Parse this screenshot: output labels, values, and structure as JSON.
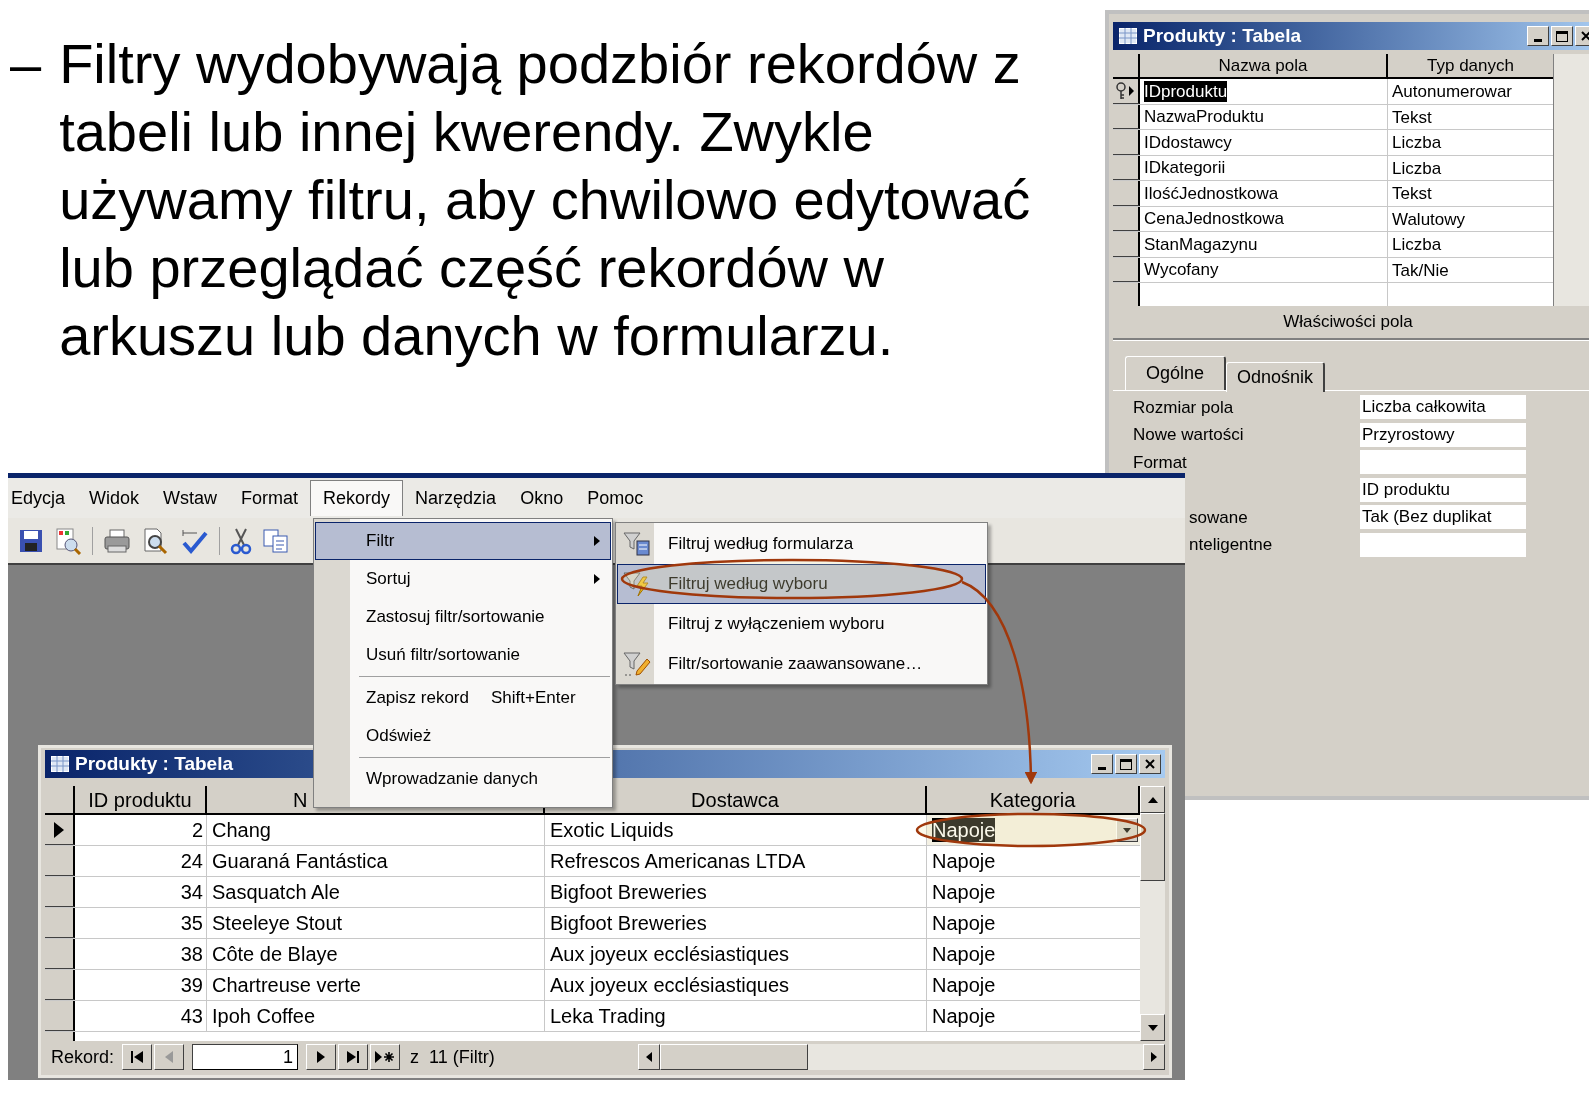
{
  "slide": {
    "bullet": "–",
    "text": "Filtry wydobywają podzbiór rekordów z tabeli lub innej kwerendy. Zwykle używamy filtru, aby chwilowo edytować lub przeglądać część rekordów w arkuszu lub danych w formularzu."
  },
  "design_window": {
    "title": "Produkty : Tabela",
    "columns": [
      "Nazwa pola",
      "Typ danych"
    ],
    "fields": [
      {
        "name": "IDproduktu",
        "type": "Autonumerowar",
        "selected": true
      },
      {
        "name": "NazwaProduktu",
        "type": "Tekst",
        "selected": false
      },
      {
        "name": "IDdostawcy",
        "type": "Liczba",
        "selected": false
      },
      {
        "name": "IDkategorii",
        "type": "Liczba",
        "selected": false
      },
      {
        "name": "IlośćJednostkowa",
        "type": "Tekst",
        "selected": false
      },
      {
        "name": "CenaJednostkowa",
        "type": "Walutowy",
        "selected": false
      },
      {
        "name": "StanMagazynu",
        "type": "Liczba",
        "selected": false
      },
      {
        "name": "Wycofany",
        "type": "Tak/Nie",
        "selected": false
      }
    ],
    "properties_title": "Właściwości pola",
    "tabs": [
      {
        "label": "Ogólne",
        "selected": true
      },
      {
        "label": "Odnośnik",
        "selected": false
      }
    ],
    "properties": [
      {
        "label": "Rozmiar pola",
        "value": "Liczba całkowita",
        "cut": false
      },
      {
        "label": "Nowe wartości",
        "value": "Przyrostowy",
        "cut": false
      },
      {
        "label": "Format",
        "cut": false
      },
      {
        "value": "ID produktu"
      },
      {
        "label": "sowane",
        "value": "Tak (Bez duplikat",
        "cut": true
      },
      {
        "label": "nteligentne",
        "cut": true
      }
    ]
  },
  "access_window": {
    "menu": [
      {
        "label": "Edycja",
        "selected": false
      },
      {
        "label": "Widok",
        "selected": false
      },
      {
        "label": "Wstaw",
        "selected": false
      },
      {
        "label": "Format",
        "selected": false
      },
      {
        "label": "Rekordy",
        "selected": true
      },
      {
        "label": "Narzędzia",
        "selected": false
      },
      {
        "label": "Okno",
        "selected": false
      },
      {
        "label": "Pomoc",
        "selected": false
      }
    ],
    "records_menu": [
      {
        "kind": "item",
        "label": "Filtr",
        "selected": true,
        "submenu": true
      },
      {
        "kind": "item",
        "label": "Sortuj",
        "selected": false,
        "submenu": true
      },
      {
        "kind": "item",
        "label": "Zastosuj filtr/sortowanie",
        "selected": false,
        "submenu": false
      },
      {
        "kind": "item",
        "label": "Usuń filtr/sortowanie",
        "selected": false,
        "submenu": false
      },
      {
        "kind": "separator"
      },
      {
        "kind": "item",
        "label": "Zapisz rekord",
        "shortcut": "Shift+Enter",
        "selected": false,
        "submenu": false
      },
      {
        "kind": "item",
        "label": "Odśwież",
        "selected": false,
        "submenu": false
      },
      {
        "kind": "separator"
      },
      {
        "kind": "item",
        "label": "Wprowadzanie danych",
        "selected": false,
        "submenu": false
      }
    ],
    "filter_submenu": [
      {
        "kind": "form",
        "label": "Filtruj według formularza",
        "selected": false
      },
      {
        "kind": "selection",
        "label": "Filtruj według wyboru",
        "selected": true
      },
      {
        "kind": "plain",
        "label": "Filtruj z wyłączeniem wyboru",
        "selected": false
      },
      {
        "kind": "advanced",
        "label": "Filtr/sortowanie zaawansowane…",
        "selected": false
      }
    ],
    "datasheet": {
      "title": "Produkty : Tabela",
      "columns": [
        "ID produktu",
        "N",
        "Dostawca",
        "Kategoria"
      ],
      "rows": [
        {
          "id": "2",
          "name": "Chang",
          "supplier": "Exotic Liquids",
          "category": "Napoje",
          "selected": true
        },
        {
          "id": "24",
          "name": "Guaraná Fantástica",
          "supplier": "Refrescos Americanas LTDA",
          "category": "Napoje",
          "selected": false
        },
        {
          "id": "34",
          "name": "Sasquatch Ale",
          "supplier": "Bigfoot Breweries",
          "category": "Napoje",
          "selected": false
        },
        {
          "id": "35",
          "name": "Steeleye Stout",
          "supplier": "Bigfoot Breweries",
          "category": "Napoje",
          "selected": false
        },
        {
          "id": "38",
          "name": "Côte de Blaye",
          "supplier": "Aux joyeux ecclésiastiques",
          "category": "Napoje",
          "selected": false
        },
        {
          "id": "39",
          "name": "Chartreuse verte",
          "supplier": "Aux joyeux ecclésiastiques",
          "category": "Napoje",
          "selected": false
        },
        {
          "id": "43",
          "name": "Ipoh Coffee",
          "supplier": "Leka Trading",
          "category": "Napoje",
          "selected": false
        }
      ],
      "navigation": {
        "label": "Rekord:",
        "current": "1",
        "total": "z  11 (Filtr)"
      }
    }
  }
}
